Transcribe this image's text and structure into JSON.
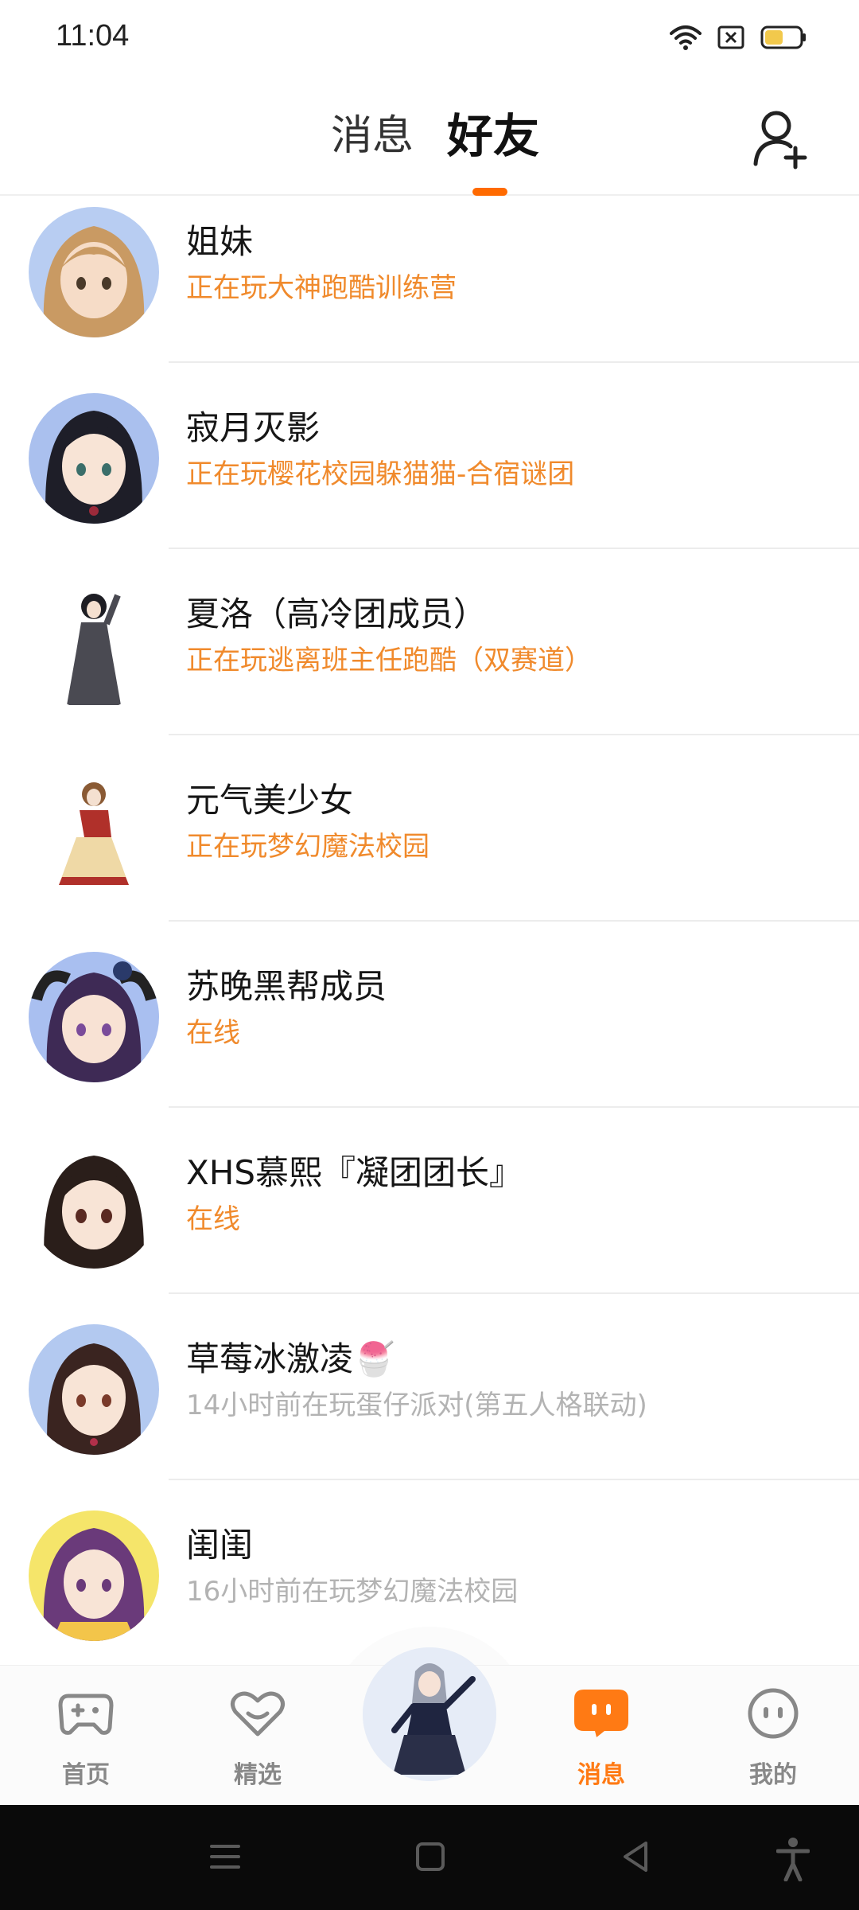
{
  "status_bar": {
    "time": "11:04"
  },
  "header": {
    "tabs": [
      {
        "label": "消息",
        "active": false
      },
      {
        "label": "好友",
        "active": true
      }
    ],
    "add_friend_icon": "add-user-icon"
  },
  "colors": {
    "accent": "#ff7a14",
    "active_status": "#f08a2c",
    "idle_status": "#b3b3b3",
    "divider": "#ececec"
  },
  "friends": [
    {
      "name": "姐妹",
      "status": "正在玩大神跑酷训练营",
      "online": true
    },
    {
      "name": "寂月灭影",
      "status": "正在玩樱花校园躲猫猫-合宿谜团",
      "online": true
    },
    {
      "name": "夏洛（高冷团成员）",
      "status": "正在玩逃离班主任跑酷（双赛道）",
      "online": true
    },
    {
      "name": "元气美少女",
      "status": "正在玩梦幻魔法校园",
      "online": true
    },
    {
      "name": "苏晚黑帮成员",
      "status": "在线",
      "online": true
    },
    {
      "name": "XHS慕熙『凝团团长』",
      "status": "在线",
      "online": true
    },
    {
      "name": "草莓冰激凌🍧",
      "status": "14小时前在玩蛋仔派对(第五人格联动)",
      "online": false
    },
    {
      "name": "闺闺",
      "status": "16小时前在玩梦幻魔法校园",
      "online": false
    }
  ],
  "bottom_nav": {
    "items": [
      {
        "label": "首页",
        "icon": "gamepad-icon",
        "active": false
      },
      {
        "label": "精选",
        "icon": "heart-icon",
        "active": false
      },
      {
        "label": "消息",
        "icon": "chat-bubble-icon",
        "active": true
      },
      {
        "label": "我的",
        "icon": "smiley-face-icon",
        "active": false
      }
    ]
  },
  "system_nav": {
    "icons": [
      "menu-icon",
      "home-icon",
      "back-icon",
      "accessibility-icon"
    ]
  }
}
